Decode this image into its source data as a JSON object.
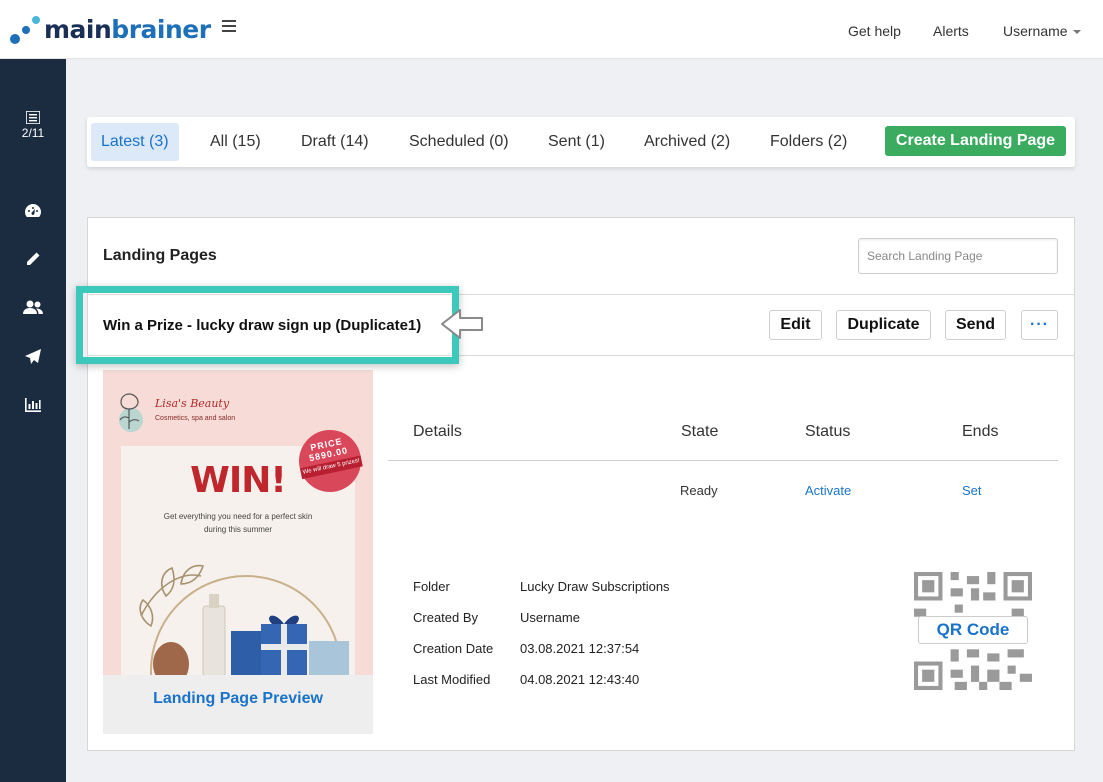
{
  "brand": {
    "name_part1": "main",
    "name_part2": "brainer"
  },
  "colors": {
    "accent": "#1a73c9",
    "create": "#3aab5f",
    "sidebar": "#1b2b40",
    "highlight": "#3cc8ba"
  },
  "header": {
    "get_help": "Get help",
    "alerts": "Alerts",
    "username": "Username"
  },
  "sidebar": {
    "items": [
      {
        "icon": "list-icon",
        "count": "2/11"
      },
      {
        "icon": "dashboard-icon"
      },
      {
        "icon": "pencil-icon"
      },
      {
        "icon": "users-icon"
      },
      {
        "icon": "paper-plane-icon"
      },
      {
        "icon": "bar-chart-icon"
      }
    ]
  },
  "tabs": [
    {
      "label": "Latest (3)",
      "active": true
    },
    {
      "label": "All (15)"
    },
    {
      "label": "Draft (14)"
    },
    {
      "label": "Scheduled (0)"
    },
    {
      "label": "Sent (1)"
    },
    {
      "label": "Archived (2)"
    },
    {
      "label": "Folders (2)"
    }
  ],
  "create_button": "Create Landing Page",
  "panel": {
    "title": "Landing Pages",
    "search_placeholder": "Search Landing Page"
  },
  "item": {
    "name": "Win a Prize - lucky draw sign up (Duplicate1)",
    "actions": {
      "edit": "Edit",
      "duplicate": "Duplicate",
      "send": "Send",
      "more": "···"
    },
    "preview": {
      "brand": "Lisa's Beauty",
      "brand_sub": "Cosmetics, spa and salon",
      "headline": "WIN!",
      "text_line1": "Get everything you need for a perfect skin",
      "text_line2": "during this summer",
      "price_label": "PRICE",
      "price_value": "5890.00",
      "badge_note": "We will draw 5 prizes!",
      "label": "Landing Page Preview"
    },
    "table": {
      "headers": {
        "details": "Details",
        "state": "State",
        "status": "Status",
        "ends": "Ends"
      },
      "state": "Ready",
      "status": "Activate",
      "ends": "Set"
    },
    "meta": [
      {
        "label": "Folder",
        "value": "Lucky Draw Subscriptions"
      },
      {
        "label": "Created By",
        "value": "Username"
      },
      {
        "label": "Creation Date",
        "value": "03.08.2021 12:37:54"
      },
      {
        "label": "Last Modified",
        "value": "04.08.2021 12:43:40"
      }
    ],
    "qr_label": "QR Code"
  }
}
